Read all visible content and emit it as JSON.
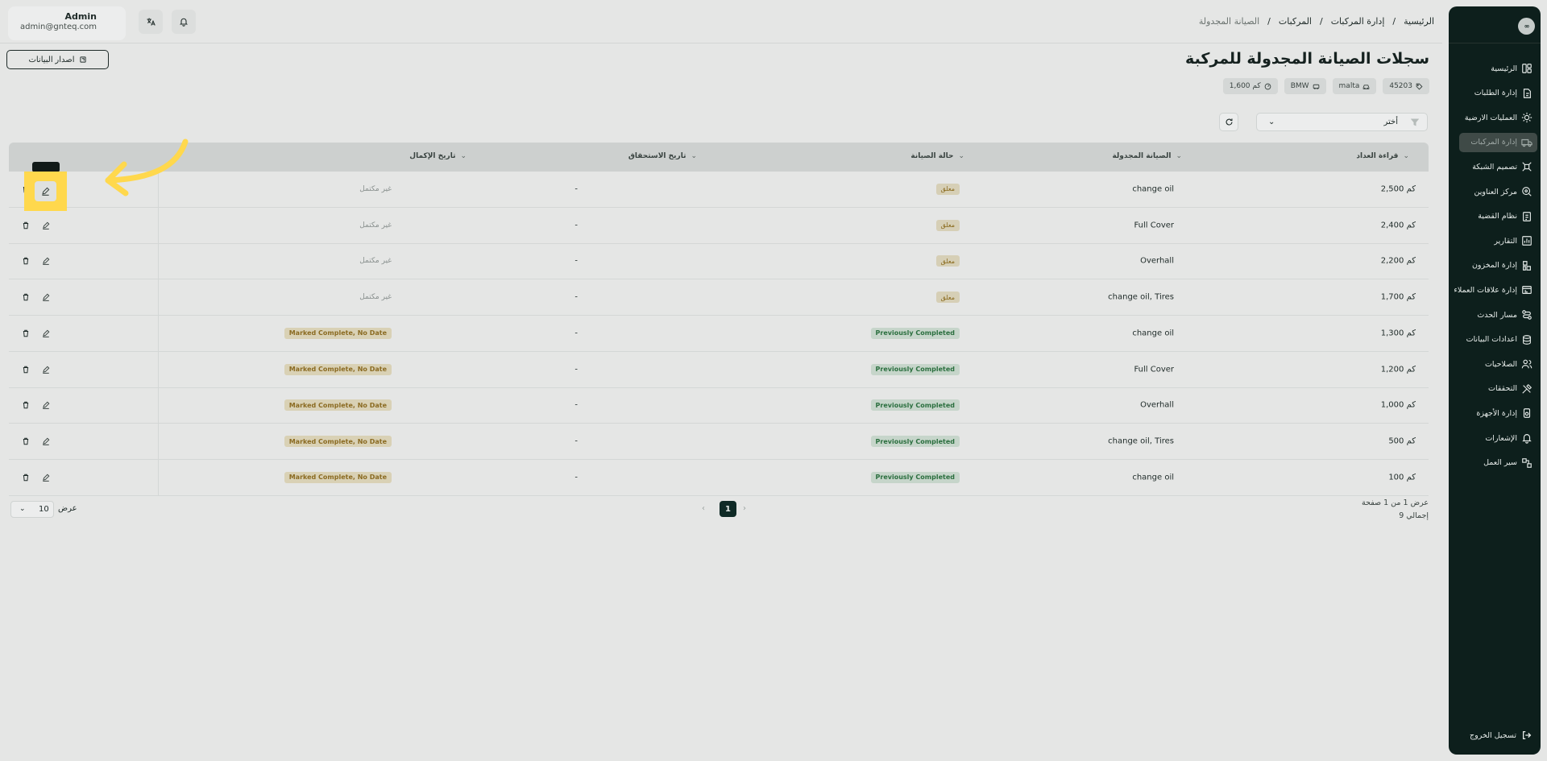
{
  "header": {
    "user_name": "Admin",
    "user_email": "admin@gnteq.com",
    "breadcrumb": [
      "الرئيسية",
      "إدارة المركبات",
      "المركبات",
      "الصيانة المجدولة"
    ],
    "breadcrumb_sep": "/"
  },
  "sidebar": {
    "logo_text": "∞",
    "items": [
      {
        "label": "الرئيسية",
        "icon": "home-icon"
      },
      {
        "label": "إدارة الطلبات",
        "icon": "orders-icon"
      },
      {
        "label": "العمليات الارضية",
        "icon": "ground-ops-icon"
      },
      {
        "label": "إدارة المركبات",
        "icon": "truck-icon"
      },
      {
        "label": "تصميم الشبكة",
        "icon": "network-icon"
      },
      {
        "label": "مركز العناوين",
        "icon": "address-icon"
      },
      {
        "label": "نظام القضية",
        "icon": "case-icon"
      },
      {
        "label": "التقارير",
        "icon": "reports-icon"
      },
      {
        "label": "إدارة المخزون",
        "icon": "inventory-icon"
      },
      {
        "label": "إدارة علاقات العملاء",
        "icon": "crm-icon"
      },
      {
        "label": "مسار الحدث",
        "icon": "route-icon"
      },
      {
        "label": "اعدادات البيانات",
        "icon": "database-icon"
      },
      {
        "label": "الصلاحيات",
        "icon": "users-icon"
      },
      {
        "label": "التحققات",
        "icon": "tools-icon"
      },
      {
        "label": "إدارة الأجهزة",
        "icon": "device-icon"
      },
      {
        "label": "الإشعارات",
        "icon": "bell-icon"
      },
      {
        "label": "سير العمل",
        "icon": "workflow-icon"
      }
    ],
    "active_index": 3,
    "logout_label": "تسجيل الخروج"
  },
  "page": {
    "title": "سجلات الصيانة المجدولة للمركبة",
    "export_label": "اصدار البيانات",
    "chips": [
      "45203",
      "malta",
      "BMW",
      "1,600 كم"
    ],
    "filter_placeholder": "أختر"
  },
  "table": {
    "columns": {
      "reading": "قراءة العداد",
      "maintenance": "الصيانة المجدولة",
      "status": "حالة الصيانة",
      "due": "تاريخ الاستحقاق",
      "completion": "تاريخ الإكمال"
    },
    "rows": [
      {
        "reading": "2,500 كم",
        "maintenance": "change oil",
        "status": "معلق",
        "status_type": "closed",
        "due": "-",
        "completion": "غير مكتمل",
        "completion_type": "muted"
      },
      {
        "reading": "2,400 كم",
        "maintenance": "Full Cover",
        "status": "معلق",
        "status_type": "closed",
        "due": "-",
        "completion": "غير مكتمل",
        "completion_type": "muted"
      },
      {
        "reading": "2,200 كم",
        "maintenance": "Overhall",
        "status": "معلق",
        "status_type": "closed",
        "due": "-",
        "completion": "غير مكتمل",
        "completion_type": "muted"
      },
      {
        "reading": "1,700 كم",
        "maintenance": "change oil, Tires",
        "status": "معلق",
        "status_type": "closed",
        "due": "-",
        "completion": "غير مكتمل",
        "completion_type": "muted"
      },
      {
        "reading": "1,300 كم",
        "maintenance": "change oil",
        "status": "Previously Completed",
        "status_type": "done",
        "due": "-",
        "completion": "Marked Complete, No Date",
        "completion_type": "badge"
      },
      {
        "reading": "1,200 كم",
        "maintenance": "Full Cover",
        "status": "Previously Completed",
        "status_type": "done",
        "due": "-",
        "completion": "Marked Complete, No Date",
        "completion_type": "badge"
      },
      {
        "reading": "1,000 كم",
        "maintenance": "Overhall",
        "status": "Previously Completed",
        "status_type": "done",
        "due": "-",
        "completion": "Marked Complete, No Date",
        "completion_type": "badge"
      },
      {
        "reading": "500 كم",
        "maintenance": "change oil, Tires",
        "status": "Previously Completed",
        "status_type": "done",
        "due": "-",
        "completion": "Marked Complete, No Date",
        "completion_type": "badge"
      },
      {
        "reading": "100 كم",
        "maintenance": "change oil",
        "status": "Previously Completed",
        "status_type": "done",
        "due": "-",
        "completion": "Marked Complete, No Date",
        "completion_type": "badge"
      }
    ]
  },
  "pagination": {
    "info_line1": "عرض 1 من 1 صفحة",
    "info_line2": "إجمالي 9",
    "current_page": "1",
    "per_page_label": "عرض",
    "per_page_value": "10"
  },
  "colors": {
    "sidebar_bg": "#0d1f1c",
    "highlight": "#ffd84d",
    "page_active": "#0f2a26"
  }
}
